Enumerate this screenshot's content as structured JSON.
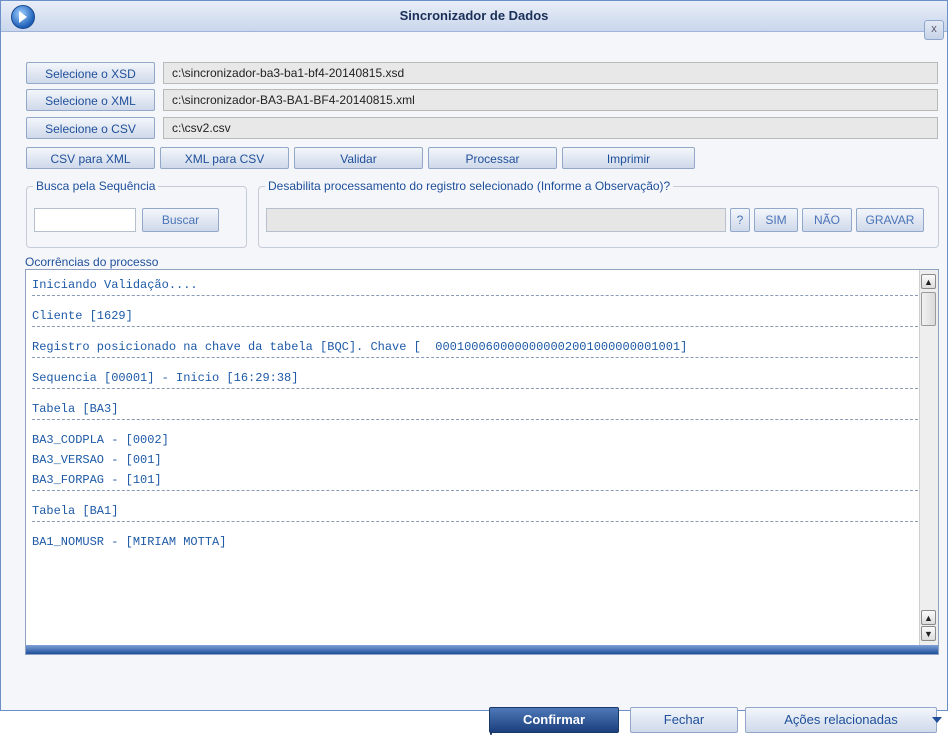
{
  "window": {
    "title": "Sincronizador de Dados",
    "close_label": "x"
  },
  "files": {
    "xsd": {
      "button": "Selecione o XSD",
      "path": "c:\\sincronizador-ba3-ba1-bf4-20140815.xsd"
    },
    "xml": {
      "button": "Selecione o XML",
      "path": "c:\\sincronizador-BA3-BA1-BF4-20140815.xml"
    },
    "csv": {
      "button": "Selecione o CSV",
      "path": "c:\\csv2.csv"
    }
  },
  "actions": {
    "csv_to_xml": "CSV para XML",
    "xml_to_csv": "XML para CSV",
    "validate": "Validar",
    "process": "Processar",
    "print": "Imprimir"
  },
  "search": {
    "legend": "Busca pela Sequência",
    "value": "",
    "button": "Buscar"
  },
  "disable": {
    "legend": "Desabilita processamento do registro selecionado (Informe a Observação)?",
    "value": "",
    "help_label": "?",
    "yes_label": "SIM",
    "no_label": "NÃO",
    "save_label": "GRAVAR"
  },
  "log": {
    "label": "Ocorrências do processo",
    "lines": [
      "Iniciando Validação....",
      "Cliente [1629]",
      "Registro posicionado na chave da tabela [BQC]. Chave [  0001000600000000002001000000001001]",
      "Sequencia [00001] - Inicio [16:29:38]",
      "Tabela [BA3]",
      "BA3_CODPLA - [0002]",
      "BA3_VERSAO - [001]",
      "BA3_FORPAG - [101]",
      "Tabela [BA1]",
      "BA1_NOMUSR - [MIRIAM MOTTA]"
    ]
  },
  "footer": {
    "confirm": "Confirmar",
    "close": "Fechar",
    "related": "Ações relacionadas"
  },
  "colors": {
    "accent": "#1f4f9a",
    "primary_button": "#1c3f7d"
  }
}
